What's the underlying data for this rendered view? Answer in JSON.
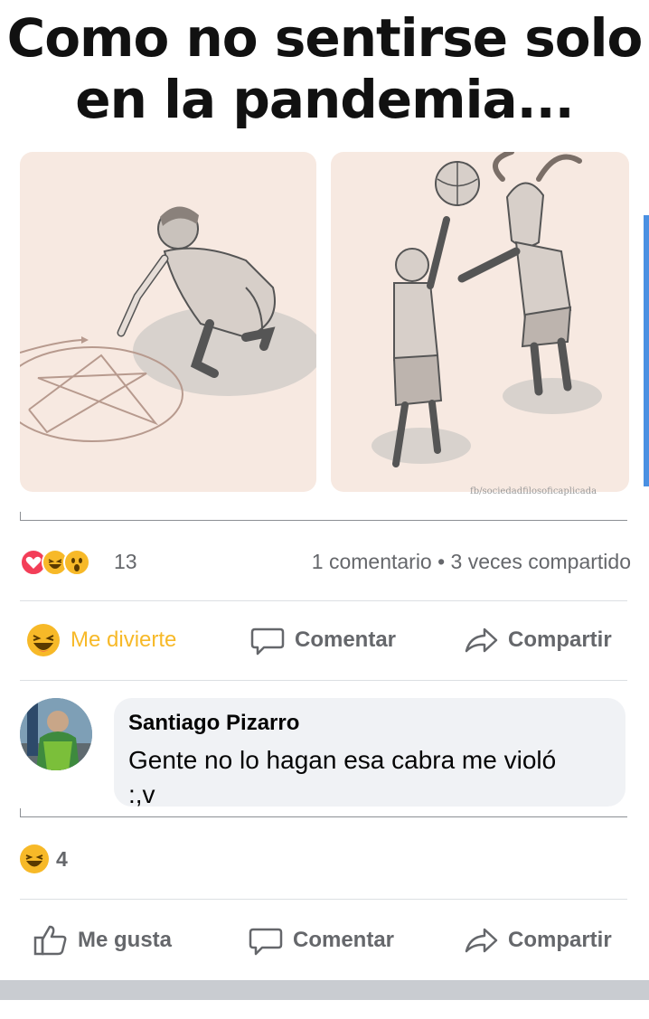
{
  "meme": {
    "title_line1": "Como no sentirse solo",
    "title_line2": "en la pandemia...",
    "watermark": "fb/sociedadfilosoficaplicada"
  },
  "post_stats": {
    "reaction_icons": [
      "love-icon",
      "haha-icon",
      "wow-icon"
    ],
    "reaction_count": "13",
    "comments_shares": "1 comentario • 3 veces compartido"
  },
  "post_actions": {
    "react_label": "Me divierte",
    "comment_label": "Comentar",
    "share_label": "Compartir"
  },
  "comment": {
    "author": "Santiago Pizarro",
    "text": "Gente no lo hagan esa cabra me violó :,v",
    "reaction_icon": "haha-icon",
    "reaction_count": "4"
  },
  "footer_actions": {
    "like_label": "Me gusta",
    "comment_label": "Comentar",
    "share_label": "Compartir"
  },
  "colors": {
    "haha": "#f7b928",
    "love": "#f33e58",
    "panel_bg": "#f7e9e1",
    "text_secondary": "#65676b"
  }
}
